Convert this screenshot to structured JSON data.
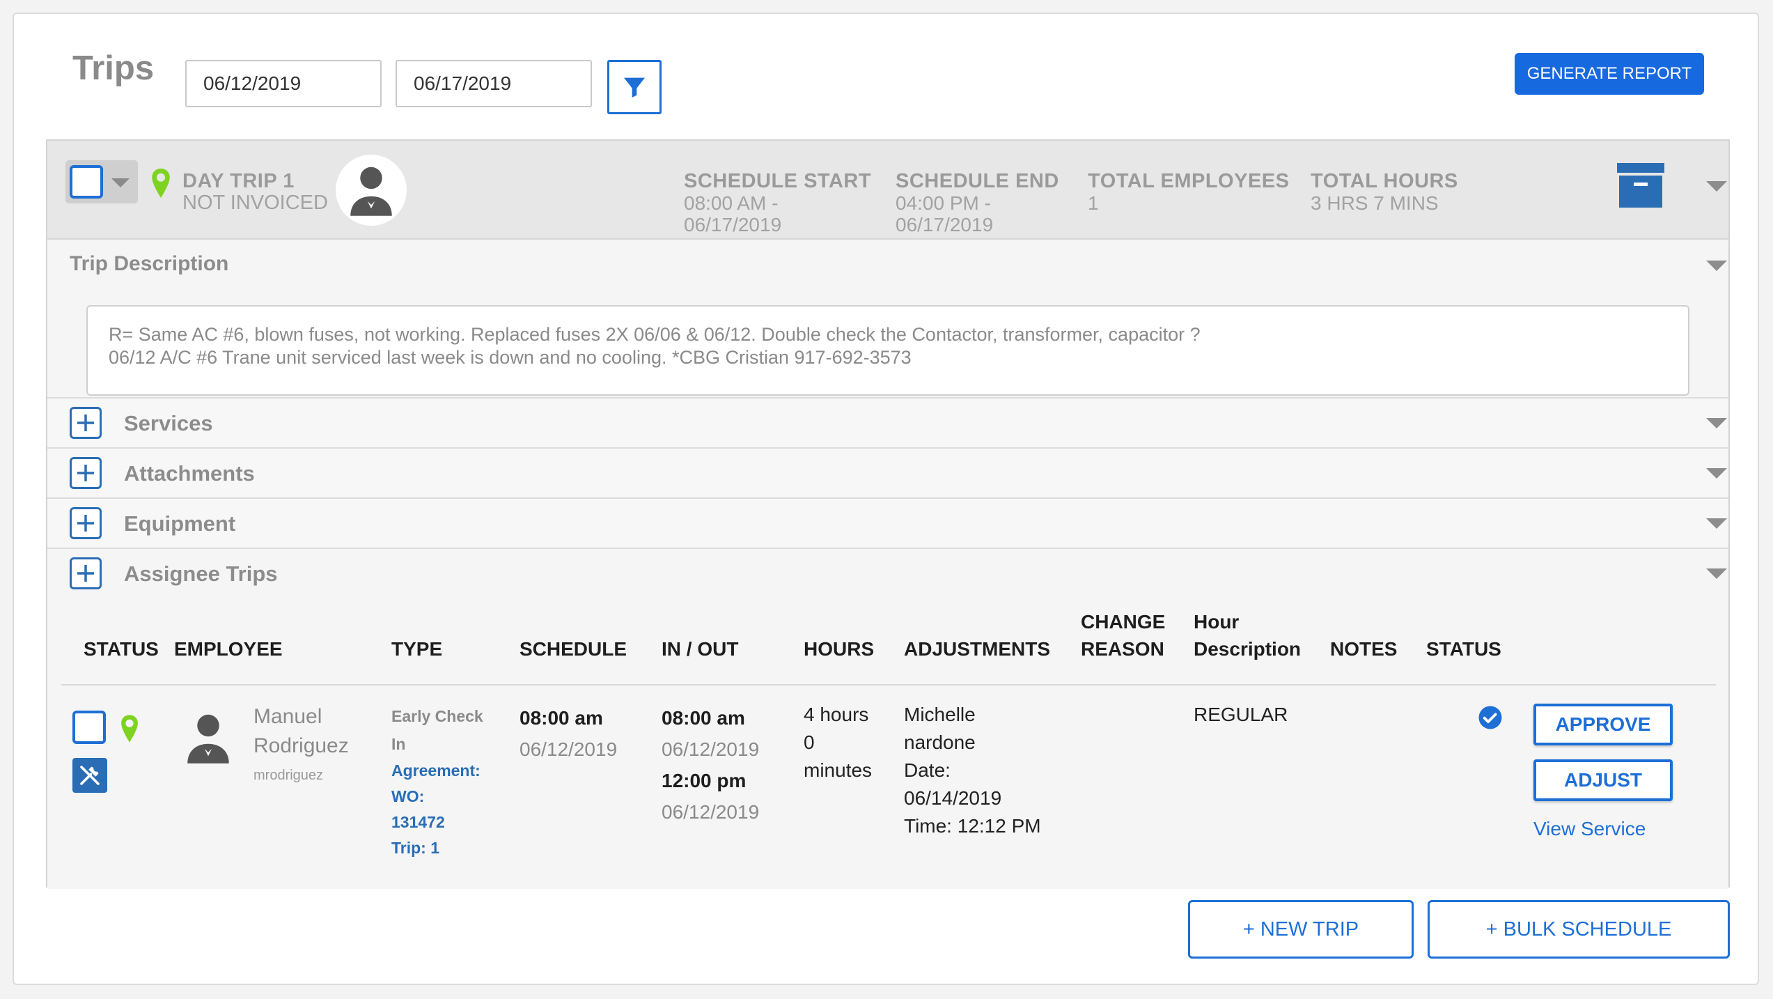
{
  "page": {
    "title": "Trips",
    "start_date": "06/12/2019",
    "end_date": "06/17/2019",
    "generate_report_label": "GENERATE REPORT",
    "filter_icon": "filter-icon"
  },
  "trip": {
    "name": "DAY TRIP 1",
    "invoice_status": "NOT INVOICED",
    "schedule_start_label": "SCHEDULE START",
    "schedule_start_time": "08:00 AM -",
    "schedule_start_date": "06/17/2019",
    "schedule_end_label": "SCHEDULE END",
    "schedule_end_time": "04:00 PM -",
    "schedule_end_date": "06/17/2019",
    "total_employees_label": "TOTAL EMPLOYEES",
    "total_employees_value": "1",
    "total_hours_label": "TOTAL HOURS",
    "total_hours_value": "3 HRS 7 MINS"
  },
  "description": {
    "label": "Trip Description",
    "line1": "R= Same AC #6, blown fuses, not working. Replaced fuses 2X 06/06 & 06/12. Double check the Contactor, transformer, capacitor ?",
    "line2": "06/12 A/C #6 Trane unit serviced last week is down and no cooling. *CBG  Cristian 917-692-3573"
  },
  "sections": {
    "services": "Services",
    "attachments": "Attachments",
    "equipment": "Equipment",
    "assignee_trips": "Assignee Trips"
  },
  "table": {
    "headers": {
      "status": "STATUS",
      "employee": "EMPLOYEE",
      "type": "TYPE",
      "schedule": "SCHEDULE",
      "in_out": "IN / OUT",
      "hours": "HOURS",
      "adjustments": "ADJUSTMENTS",
      "change_reason_1": "CHANGE",
      "change_reason_2": "REASON",
      "hour_desc_1": "Hour",
      "hour_desc_2": "Description",
      "notes": "NOTES",
      "status2": "STATUS"
    },
    "row": {
      "employee_first": "Manuel",
      "employee_last": "Rodriguez",
      "username": "mrodriguez",
      "type_1": "Early Check",
      "type_2": "In",
      "agreement": "Agreement:",
      "wo_label": "WO:",
      "wo_number": "131472",
      "trip": "Trip: 1",
      "schedule_time": "08:00 am",
      "schedule_date": "06/12/2019",
      "in_time": "08:00 am",
      "in_date": "06/12/2019",
      "out_time": "12:00 pm",
      "out_date": "06/12/2019",
      "hours_1": "4 hours",
      "hours_2": "0",
      "hours_3": "minutes",
      "adj_1": "Michelle",
      "adj_2": "nardone",
      "adj_3": "Date:",
      "adj_4": "06/14/2019",
      "adj_5": "Time: 12:12 PM",
      "hour_description": "REGULAR",
      "approve_label": "APPROVE",
      "adjust_label": "ADJUST",
      "view_service_label": "View Service"
    }
  },
  "footer": {
    "new_trip_label": "+ NEW TRIP",
    "bulk_schedule_label": "+ BULK SCHEDULE"
  },
  "colors": {
    "accent": "#1d6fd6",
    "pin_green": "#7ed321",
    "archive_blue": "#2a6db5"
  }
}
